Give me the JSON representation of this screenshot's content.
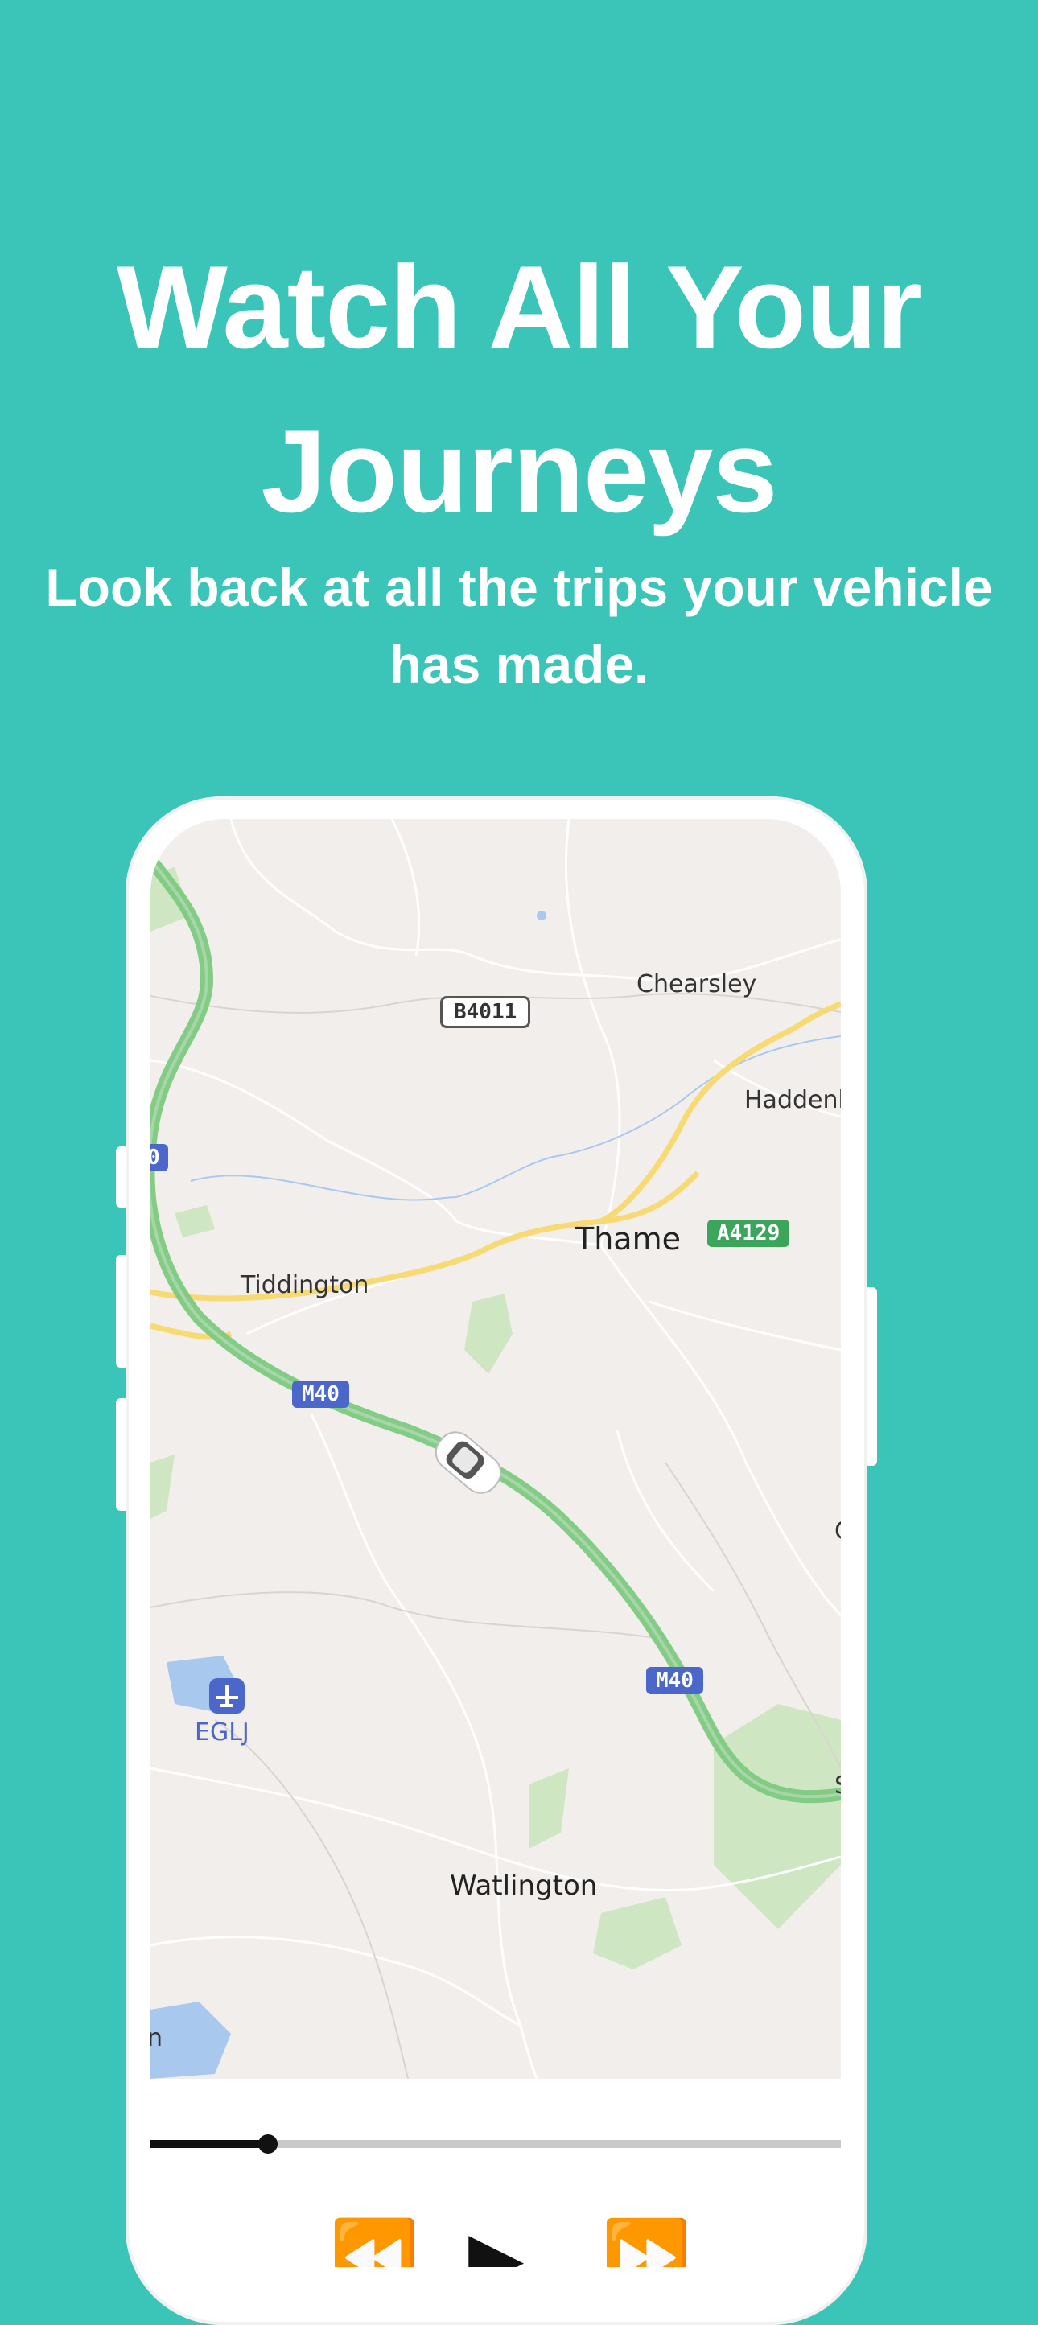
{
  "headline": "Watch All Your Journeys",
  "subheadline": "Look back at all the trips your vehicle has made.",
  "map": {
    "places": {
      "chearsley": "Chearsley",
      "haddenham": "Haddenh",
      "thame": "Thame",
      "tiddington": "Tiddington",
      "watlington": "Watlington",
      "airport": "EGLJ",
      "edge_c": "C",
      "edge_s": "S",
      "edge_n": "n"
    },
    "road_badges": {
      "b4011": "B4011",
      "a4129": "A4129",
      "m40_a": "M40",
      "m40_b": "M40",
      "edge_m40": "0"
    },
    "route_color": "#7cc97f",
    "motorway_badge_color": "#4a67c9",
    "a_road_badge_color": "#3ba55c"
  },
  "player": {
    "progress": 0.17,
    "rewind_icon": "rewind-icon",
    "play_icon": "play-icon",
    "forward_icon": "fast-forward-icon"
  },
  "colors": {
    "background": "#3bc5b8",
    "text": "#ffffff"
  }
}
